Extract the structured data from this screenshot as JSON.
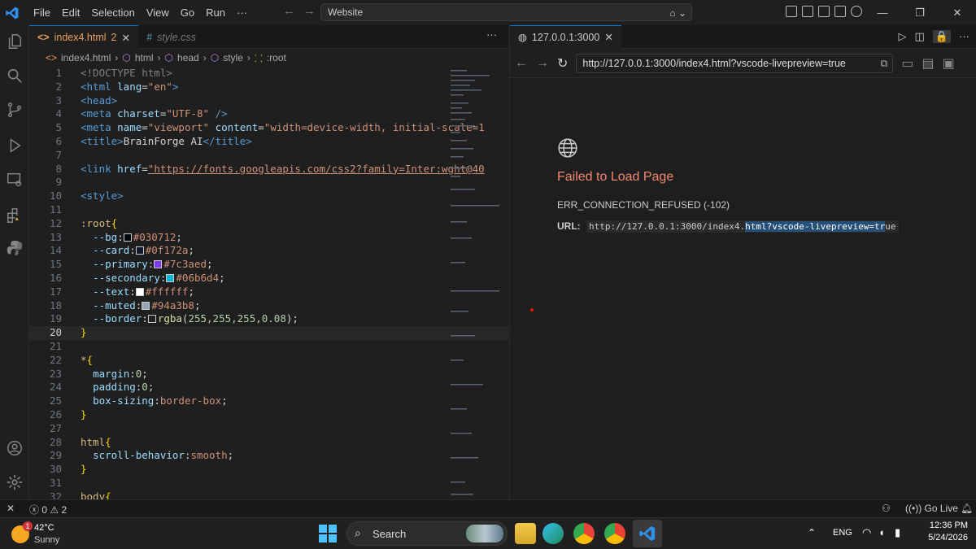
{
  "menu": [
    "File",
    "Edit",
    "Selection",
    "View",
    "Go",
    "Run",
    "···"
  ],
  "command_center": {
    "text": "Website"
  },
  "tabs": {
    "active": {
      "label": "index4.html",
      "badge": "2"
    },
    "inactive": {
      "label": "style.css"
    },
    "more": "···"
  },
  "breadcrumb": [
    "index4.html",
    "html",
    "head",
    "style",
    ":root"
  ],
  "code_lines": [
    {
      "n": "1"
    },
    {
      "n": "2"
    },
    {
      "n": "3"
    },
    {
      "n": "4"
    },
    {
      "n": "5"
    },
    {
      "n": "6"
    },
    {
      "n": "7"
    },
    {
      "n": "8"
    },
    {
      "n": "9"
    },
    {
      "n": "10"
    },
    {
      "n": "11"
    },
    {
      "n": "12"
    },
    {
      "n": "13"
    },
    {
      "n": "14"
    },
    {
      "n": "15"
    },
    {
      "n": "16"
    },
    {
      "n": "17"
    },
    {
      "n": "18"
    },
    {
      "n": "19"
    },
    {
      "n": "20"
    },
    {
      "n": "21"
    },
    {
      "n": "22"
    },
    {
      "n": "23"
    },
    {
      "n": "24"
    },
    {
      "n": "25"
    },
    {
      "n": "26"
    },
    {
      "n": "27"
    },
    {
      "n": "28"
    },
    {
      "n": "29"
    },
    {
      "n": "30"
    },
    {
      "n": "31"
    },
    {
      "n": "32"
    }
  ],
  "code": {
    "l1": "<!DOCTYPE html>",
    "l2a": "<html ",
    "l2b": "lang",
    "l2c": "=",
    "l2d": "\"en\"",
    "l2e": ">",
    "l3": "<head>",
    "l4a": "<meta ",
    "l4b": "charset",
    "l4c": "=",
    "l4d": "\"UTF-8\"",
    "l4e": " />",
    "l5a": "<meta ",
    "l5b": "name",
    "l5c": "=",
    "l5d": "\"viewport\"",
    "l5e": " content",
    "l5f": "=",
    "l5g": "\"width=device-width, initial-scale=1",
    "l6a": "<title>",
    "l6b": "BrainForge AI",
    "l6c": "</title>",
    "l8a": "<link ",
    "l8b": "href",
    "l8c": "=",
    "l8d": "\"https://fonts.googleapis.com/css2?family=Inter:wght@40",
    "l10": "<style>",
    "l12a": ":root",
    "l12b": "{",
    "l13a": "--bg",
    "l13b": ":",
    "l13c": "#030712",
    "l13d": ";",
    "l14a": "--card",
    "l14b": ":",
    "l14c": "#0f172a",
    "l14d": ";",
    "l15a": "--primary",
    "l15b": ":",
    "l15c": "#7c3aed",
    "l15d": ";",
    "l16a": "--secondary",
    "l16b": ":",
    "l16c": "#06b6d4",
    "l16d": ";",
    "l17a": "--text",
    "l17b": ":",
    "l17c": "#ffffff",
    "l17d": ";",
    "l18a": "--muted",
    "l18b": ":",
    "l18c": "#94a3b8",
    "l18d": ";",
    "l19a": "--border",
    "l19b": ":",
    "l19c": "rgba",
    "l19d": "(",
    "l19e": "255,255,255,0.08",
    "l19f": ");",
    "l20": "}",
    "l22a": "*",
    "l22b": "{",
    "l23a": "margin",
    "l23b": ":",
    "l23c": "0",
    "l23d": ";",
    "l24a": "padding",
    "l24b": ":",
    "l24c": "0",
    "l24d": ";",
    "l25a": "box-sizing",
    "l25b": ":",
    "l25c": "border-box",
    "l25d": ";",
    "l26": "}",
    "l28a": "html",
    "l28b": "{",
    "l29a": "scroll-behavior",
    "l29b": ":",
    "l29c": "smooth",
    "l29d": ";",
    "l30": "}",
    "l32a": "body",
    "l32b": "{"
  },
  "swatches": {
    "bg": "#030712",
    "card": "#0f172a",
    "primary": "#7c3aed",
    "secondary": "#06b6d4",
    "text": "#ffffff",
    "muted": "#94a3b8",
    "border": "#1f1f1f"
  },
  "preview": {
    "tab_label": "127.0.0.1:3000",
    "url": "http://127.0.0.1:3000/index4.html?vscode-livepreview=true",
    "error_title": "Failed to Load Page",
    "error_code": "ERR_CONNECTION_REFUSED (-102)",
    "url_label": "URL:",
    "url_plain": "http://127.0.0.1:3000/index4.",
    "url_selected": "html?vscode-livepreview=tr",
    "url_tail": "ue"
  },
  "status": {
    "errors": "0",
    "warnings": "2",
    "go_live": "Go Live"
  },
  "taskbar": {
    "weather_temp": "42°C",
    "weather_desc": "Sunny",
    "weather_badge": "1",
    "search": "Search",
    "lang": "ENG",
    "time": "12:36 PM",
    "date": "5/24/2026"
  },
  "colors": {
    "accent": "#0078d4",
    "error": "#f48771",
    "tab_active_text": "#e8a15c"
  }
}
